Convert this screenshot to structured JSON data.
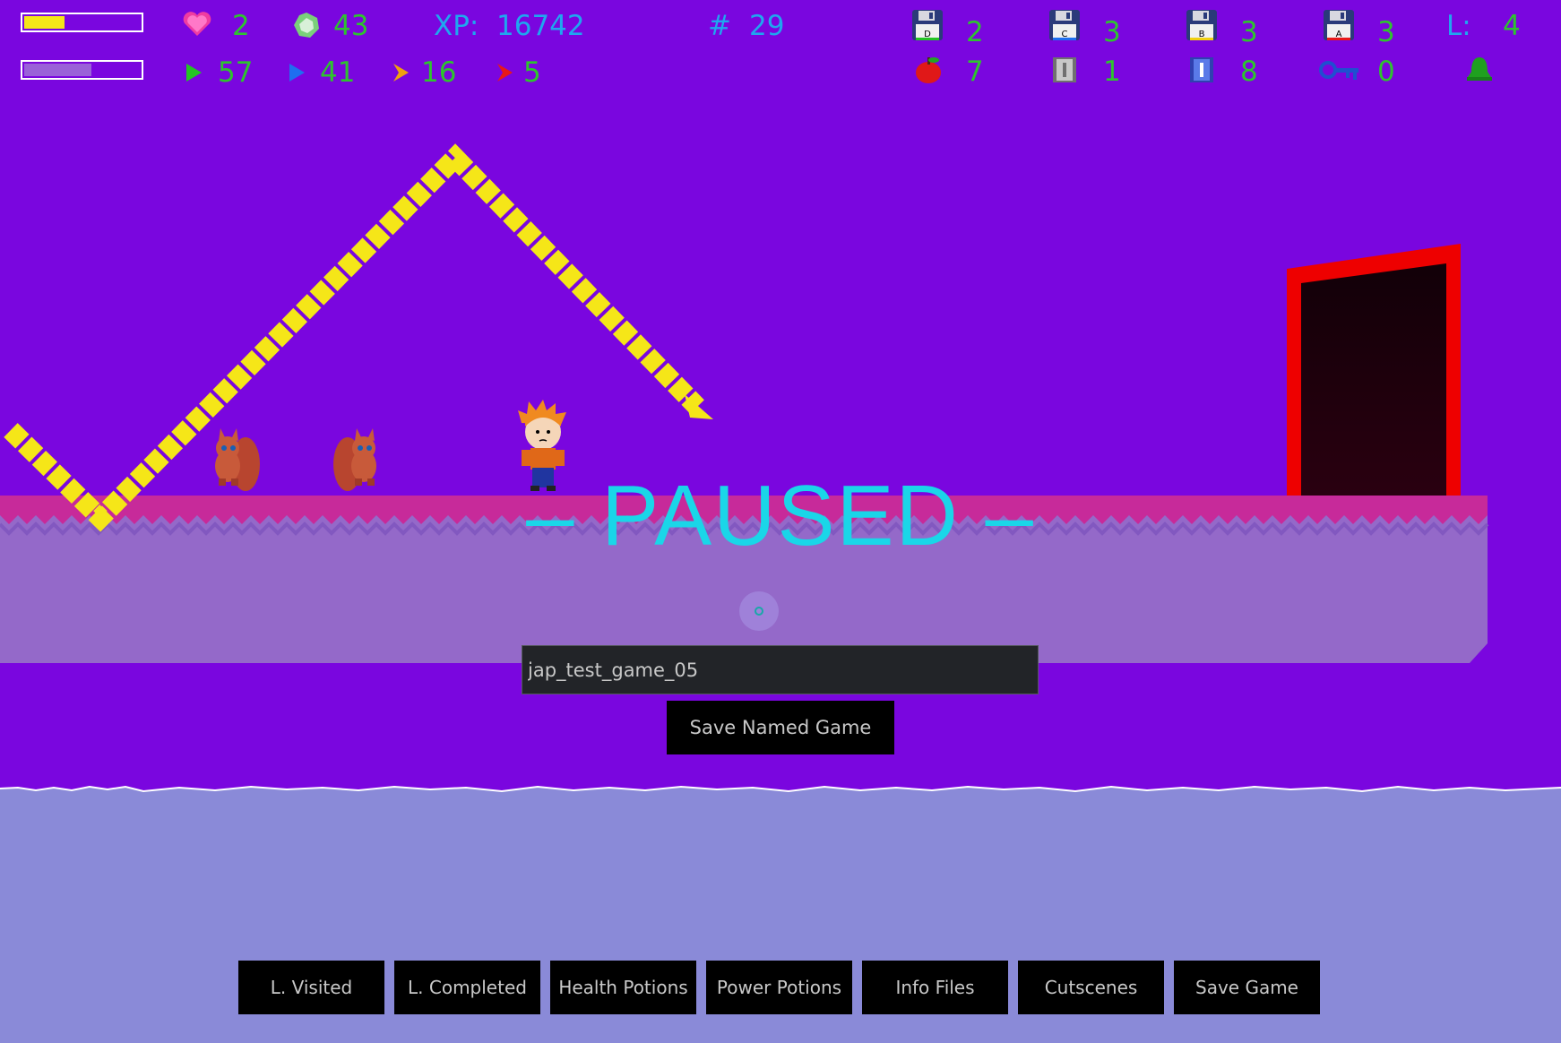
{
  "hud": {
    "lives": "2",
    "gems": "43",
    "xp_label": "XP:",
    "xp_value": "16742",
    "hash_label": "#",
    "hash_value": "29",
    "health_fraction": 0.35,
    "power_fraction": 0.58,
    "arrows": [
      {
        "icon": "green-arrow-icon",
        "value": "57"
      },
      {
        "icon": "blue-arrow-icon",
        "value": "41"
      },
      {
        "icon": "orange-chevron-icon",
        "value": "16"
      },
      {
        "icon": "red-chevron-icon",
        "value": "5"
      }
    ],
    "disks": [
      {
        "letter": "D",
        "value": "2"
      },
      {
        "letter": "C",
        "value": "3"
      },
      {
        "letter": "B",
        "value": "3"
      },
      {
        "letter": "A",
        "value": "3"
      }
    ],
    "level_label": "L:",
    "level_value": "4",
    "apples": "7",
    "grey_files": "1",
    "blue_files": "8",
    "keys": "0"
  },
  "paused_text": "– PAUSED –",
  "save_name": {
    "value": "jap_test_game_05",
    "button_label": "Save Named Game"
  },
  "menu": [
    "L. Visited",
    "L. Completed",
    "Health Potions",
    "Power Potions",
    "Info Files",
    "Cutscenes",
    "Save Game"
  ],
  "colors": {
    "sky": "#7a06df",
    "hud_text": "#2ec42e",
    "xp_text": "#1fa7ef",
    "paused_text": "#1ad6e8",
    "zigzag": "#f5e618",
    "door": "#ee0000",
    "water": "#8a8ad8",
    "platform_top": "#c72a9a",
    "platform_body": "#9469c9"
  }
}
